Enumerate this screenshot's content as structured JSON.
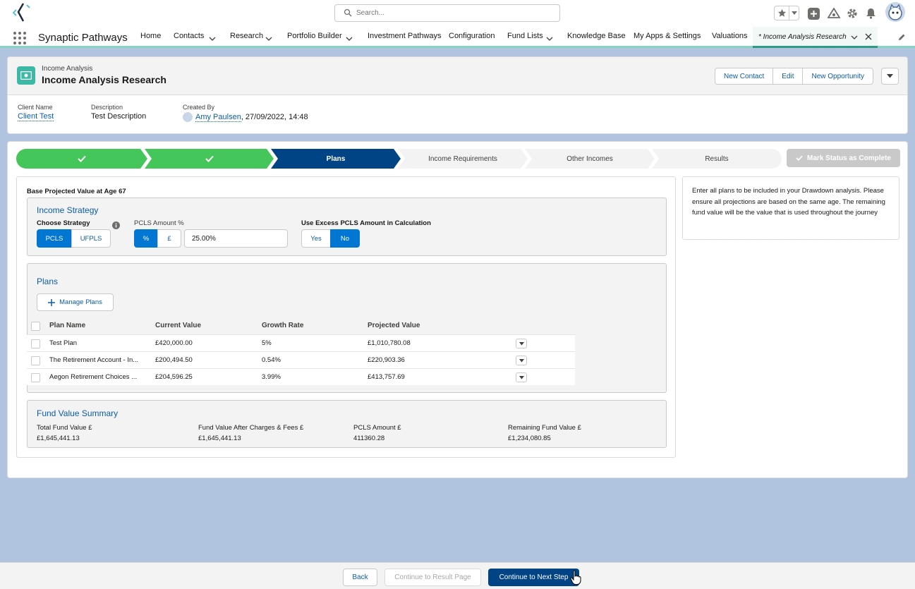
{
  "search": {
    "placeholder": "Search..."
  },
  "app": {
    "name": "Synaptic Pathways"
  },
  "nav": {
    "items": [
      {
        "label": "Home"
      },
      {
        "label": "Contacts"
      },
      {
        "label": "Research"
      },
      {
        "label": "Portfolio Builder"
      },
      {
        "label": "Investment Pathways"
      },
      {
        "label": "Configuration"
      },
      {
        "label": "Fund Lists"
      },
      {
        "label": "Knowledge Base"
      },
      {
        "label": "My Apps & Settings"
      },
      {
        "label": "Valuations"
      }
    ],
    "active_tab": "* Income Analysis Research"
  },
  "record": {
    "object_label": "Income Analysis",
    "title": "Income Analysis Research",
    "actions": {
      "new_contact": "New Contact",
      "edit": "Edit",
      "new_opportunity": "New Opportunity"
    },
    "fields": {
      "client_name_label": "Client Name",
      "client_name": "Client Test",
      "description_label": "Description",
      "description": "Test Description",
      "created_by_label": "Created By",
      "created_by": "Amy Paulsen",
      "created_date": ", 27/09/2022, 14:48"
    }
  },
  "path": {
    "steps": [
      {
        "label": "",
        "status": "complete"
      },
      {
        "label": "",
        "status": "complete"
      },
      {
        "label": "Plans",
        "status": "current"
      },
      {
        "label": "Income Requirements",
        "status": "incomplete"
      },
      {
        "label": "Other Incomes",
        "status": "incomplete"
      },
      {
        "label": "Results",
        "status": "incomplete"
      }
    ],
    "mark_complete": "Mark Status as Complete"
  },
  "base_projection": "Base Projected Value at Age 67",
  "strategy": {
    "title": "Income Strategy",
    "choose_label": "Choose Strategy",
    "options": [
      "PCLS",
      "UFPLS"
    ],
    "selected": "PCLS",
    "pcls_label": "PCLS Amount %",
    "unit_options": [
      "%",
      "£"
    ],
    "unit_selected": "%",
    "pcls_value": "25.00%",
    "excess_label": "Use Excess PCLS Amount in Calculation",
    "excess_options": [
      "Yes",
      "No"
    ],
    "excess_selected": "No"
  },
  "plans": {
    "title": "Plans",
    "manage_label": "Manage Plans",
    "columns": [
      "Plan Name",
      "Current Value",
      "Growth Rate",
      "Projected Value"
    ],
    "rows": [
      {
        "name": "Test Plan",
        "current": "£420,000.00",
        "growth": "5%",
        "projected": "£1,010,780.08"
      },
      {
        "name": "The Retirement Account - In...",
        "current": "£200,494.50",
        "growth": "0.54%",
        "projected": "£220,903.36"
      },
      {
        "name": "Aegon Retirement Choices ...",
        "current": "£204,596.25",
        "growth": "3.99%",
        "projected": "£413,757.69"
      }
    ]
  },
  "summary": {
    "title": "Fund Value Summary",
    "items": [
      {
        "label": "Total Fund Value £",
        "value": "£1,645,441.13"
      },
      {
        "label": "Fund Value After Charges & Fees £",
        "value": "£1,645,441.13"
      },
      {
        "label": "PCLS Amount £",
        "value": "411360.28"
      },
      {
        "label": "Remaining Fund Value £",
        "value": "£1,234,080.85"
      }
    ]
  },
  "info": {
    "text": "Enter all plans to be included in your Drawdown analysis. Please ensure all projections are based on the same age. The remaining fund value will be the value that is used throughout the journey"
  },
  "footer": {
    "back": "Back",
    "result_page": "Continue to Result Page",
    "next": "Continue to Next Step"
  },
  "colors": {
    "brand": "#0176d3",
    "path_complete": "#45c65a",
    "path_current": "#014486",
    "accent_tab": "#2a9c86"
  }
}
